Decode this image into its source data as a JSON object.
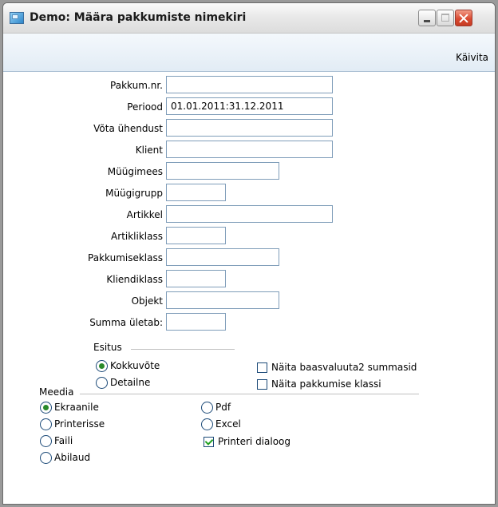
{
  "window": {
    "title": "Demo: Määra pakkumiste nimekiri",
    "run_label": "Käivita"
  },
  "fields": [
    {
      "label": "Pakkum.nr.",
      "value": ""
    },
    {
      "label": "Periood",
      "value": "01.01.2011:31.12.2011"
    },
    {
      "label": "Võta ühendust",
      "value": ""
    },
    {
      "label": "Klient",
      "value": ""
    },
    {
      "label": "Müügimees",
      "value": ""
    },
    {
      "label": "Müügigrupp",
      "value": ""
    },
    {
      "label": "Artikkel",
      "value": ""
    },
    {
      "label": "Artikliklass",
      "value": ""
    },
    {
      "label": "Pakkumiseklass",
      "value": ""
    },
    {
      "label": "Kliendiklass",
      "value": ""
    },
    {
      "label": "Objekt",
      "value": ""
    },
    {
      "label": "Summa ületab:",
      "value": ""
    }
  ],
  "esitus": {
    "title": "Esitus",
    "options": [
      {
        "label": "Kokkuvõte",
        "selected": true
      },
      {
        "label": "Detailne",
        "selected": false
      }
    ]
  },
  "checkboxes": [
    {
      "label": "Näita baasvaluuta2 summasid",
      "checked": false
    },
    {
      "label": "Näita pakkumise klassi",
      "checked": false
    },
    {
      "label": "Printeri dialoog",
      "checked": true
    }
  ],
  "meedia": {
    "title": "Meedia",
    "options": [
      {
        "label": "Ekraanile",
        "selected": true
      },
      {
        "label": "Printerisse",
        "selected": false
      },
      {
        "label": "Faili",
        "selected": false
      },
      {
        "label": "Abilaud",
        "selected": false
      },
      {
        "label": "Pdf",
        "selected": false
      },
      {
        "label": "Excel",
        "selected": false
      }
    ]
  }
}
